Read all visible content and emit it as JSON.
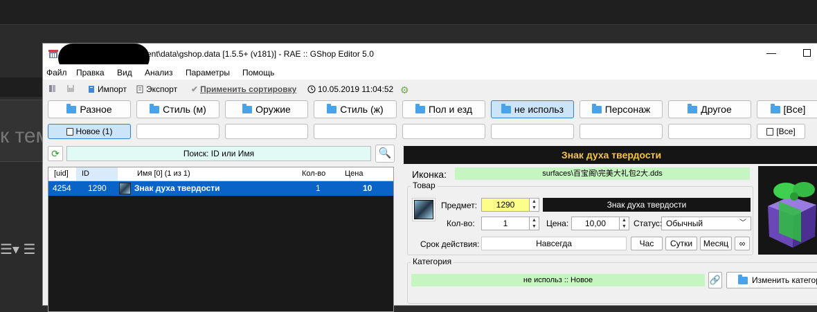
{
  "window": {
    "title": "ment\\data\\gshop.data [1.5.5+ (v181)] - RAE :: GShop Editor 5.0",
    "minimize": "—"
  },
  "background": {
    "ghost_text": "к тем",
    "menu_icon": "☰▾ ☰"
  },
  "menu": [
    "Файл",
    "Правка",
    "Вид",
    "Анализ",
    "Параметры",
    "Помощь"
  ],
  "toolbar": {
    "import": "Импорт",
    "export": "Экспорт",
    "apply_sort": "Применить сортировку",
    "timestamp": "10.05.2019 11:04:52"
  },
  "categories": [
    {
      "label": "Разное",
      "active": false
    },
    {
      "label": "Стиль (м)",
      "active": false
    },
    {
      "label": "Оружие",
      "active": false
    },
    {
      "label": "Стиль (ж)",
      "active": false
    },
    {
      "label": "Пол и езд",
      "active": false
    },
    {
      "label": "не использ",
      "active": true
    },
    {
      "label": "Персонаж",
      "active": false
    },
    {
      "label": "Другое",
      "active": false
    },
    {
      "label": "[Все]",
      "active": false
    }
  ],
  "subcategories": [
    "Новое (1)",
    "",
    "",
    "",
    "",
    "",
    "",
    "",
    "[Все]"
  ],
  "search": {
    "placeholder": "Поиск: ID или Имя",
    "refresh_icon": "⟳",
    "search_icon": "🔍"
  },
  "list": {
    "columns": [
      "[uid]",
      "ID",
      "Имя [0] (1 из 1)",
      "Кол-во",
      "Цена"
    ],
    "rows": [
      {
        "uid": "4254",
        "id": "1290",
        "name": "Знак духа твердости",
        "qty": "1",
        "price": "10"
      }
    ]
  },
  "detail": {
    "title": "Знак духа твердости",
    "icon_label": "Иконка:",
    "icon_path": "surfaces\\百宝阁\\完美大礼包2大.dds",
    "goods_group": "Товар",
    "item_label": "Предмет:",
    "item_id": "1290",
    "item_name": "Знак духа твердости",
    "qty_label": "Кол-во:",
    "qty": "1",
    "price_label": "Цена:",
    "price": "10,00",
    "status_label": "Статус:",
    "status": "Обычный",
    "duration_label": "Срок действия:",
    "duration": "Навсегда",
    "duration_buttons": [
      "Час",
      "Сутки",
      "Месяц",
      "∞"
    ],
    "category_group": "Категория",
    "category_path": "не использ :: Новое",
    "change_category": "Изменить категори"
  }
}
